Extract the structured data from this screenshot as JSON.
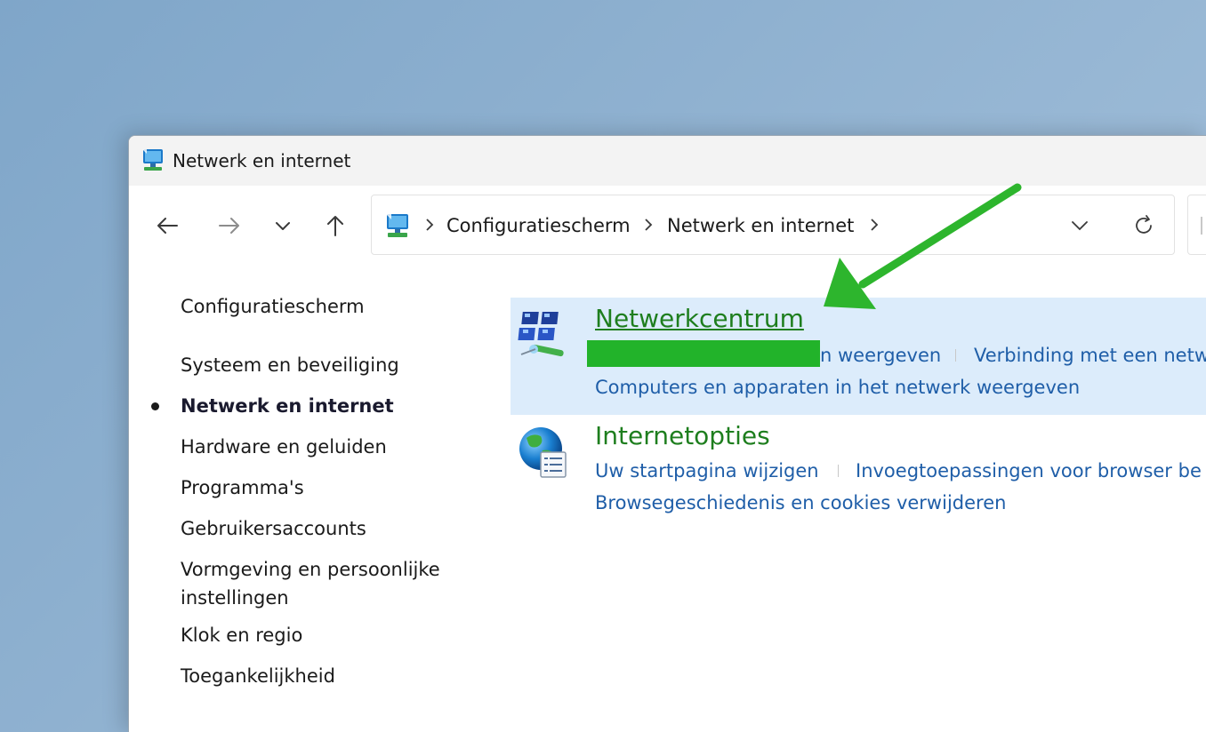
{
  "window": {
    "title": "Netwerk en internet"
  },
  "navigation": {
    "back_icon": "arrow-left-icon",
    "forward_icon": "arrow-right-icon",
    "recent_icon": "chevron-down-icon",
    "up_icon": "arrow-up-icon"
  },
  "address_bar": {
    "breadcrumbs": [
      "Configuratiescherm",
      "Netwerk en internet"
    ],
    "dropdown_icon": "chevron-down-icon",
    "refresh_icon": "refresh-icon"
  },
  "sidebar": {
    "items": [
      {
        "label": "Configuratiescherm",
        "active": false
      },
      {
        "label": "Systeem en beveiliging",
        "active": false
      },
      {
        "label": "Netwerk en internet",
        "active": true
      },
      {
        "label": "Hardware en geluiden",
        "active": false
      },
      {
        "label": "Programma's",
        "active": false
      },
      {
        "label": "Gebruikersaccounts",
        "active": false
      },
      {
        "label": "Vormgeving en persoonlijke",
        "label2": "instellingen",
        "active": false
      },
      {
        "label": "Klok en regio",
        "active": false
      },
      {
        "label": "Toegankelijkheid",
        "active": false
      }
    ]
  },
  "categories": [
    {
      "title": "Netwerkcentrum",
      "icon": "network-center-icon",
      "links": [
        "n weergeven",
        "Verbinding met een netw",
        "Computers en apparaten in het netwerk weergeven"
      ]
    },
    {
      "title": "Internetopties",
      "icon": "internet-options-globe-icon",
      "links": [
        "Uw startpagina wijzigen",
        "Invoegtoepassingen voor browser be",
        "Browsegeschiedenis en cookies verwijderen"
      ]
    }
  ],
  "colors": {
    "highlight": "#dcecfb",
    "category_title": "#1e7e1e",
    "link": "#1f5ea8",
    "annotation_arrow": "#2db52d",
    "redaction": "#22b32a"
  }
}
